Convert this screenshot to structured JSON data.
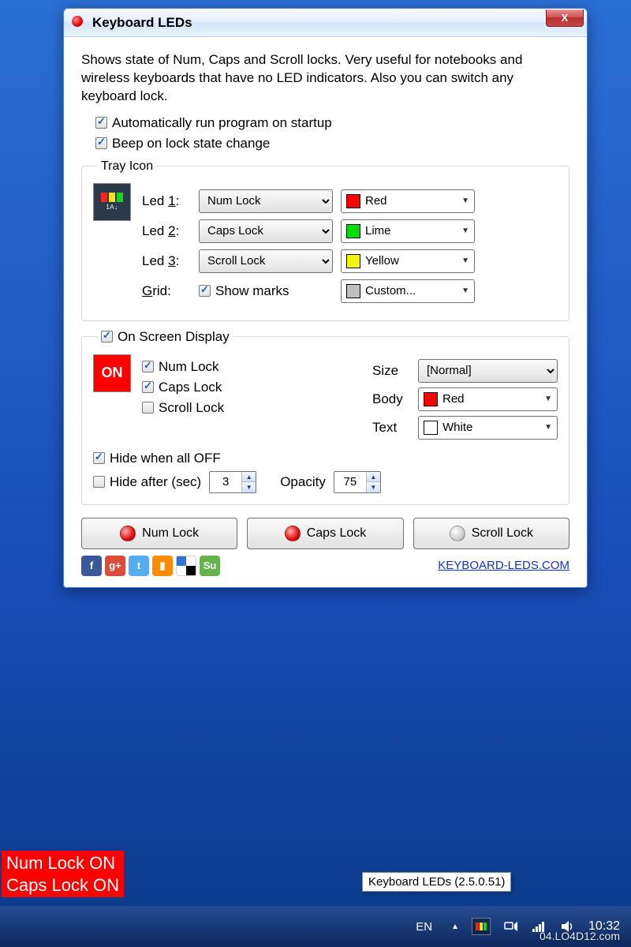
{
  "window": {
    "title": "Keyboard LEDs",
    "close_glyph": "X"
  },
  "description": "Shows state of Num, Caps and Scroll locks. Very useful for notebooks and wireless keyboards that have no LED indicators. Also you can switch any keyboard lock.",
  "opt_autorun": "Automatically run program on startup",
  "opt_beep": "Beep on lock state change",
  "tray": {
    "legend": "Tray Icon",
    "icon_sub": "1A↓",
    "leds": [
      {
        "label_pre": "Led ",
        "key": "1",
        "label_post": ":",
        "lock": "Num Lock",
        "color_name": "Red",
        "swatch": "#ff0000"
      },
      {
        "label_pre": "Led ",
        "key": "2",
        "label_post": ":",
        "lock": "Caps Lock",
        "color_name": "Lime",
        "swatch": "#00e000"
      },
      {
        "label_pre": "Led ",
        "key": "3",
        "label_post": ":",
        "lock": "Scroll Lock",
        "color_name": "Yellow",
        "swatch": "#f5f500"
      }
    ],
    "grid_label_pre": "G",
    "grid_label_post": "rid:",
    "grid_show": "Show marks",
    "grid_color_name": "Custom...",
    "grid_swatch": "#bfbfbf"
  },
  "osd": {
    "legend": "On Screen Display",
    "icon_text": "ON",
    "chk_num": "Num Lock",
    "chk_caps": "Caps Lock",
    "chk_scroll": "Scroll Lock",
    "chk_hide_all": "Hide when all OFF",
    "chk_hide_after": "Hide after (sec)",
    "hide_after_value": "3",
    "opacity_label": "Opacity",
    "opacity_value": "75",
    "size_label": "Size",
    "size_value": "[Normal]",
    "body_label": "Body",
    "body_color_name": "Red",
    "body_swatch": "#ff0000",
    "text_label": "Text",
    "text_color_name": "White",
    "text_swatch": "#ffffff"
  },
  "buttons": {
    "num": "Num Lock",
    "caps": "Caps Lock",
    "scroll": "Scroll Lock"
  },
  "footer": {
    "url": "KEYBOARD-LEDS.COM"
  },
  "overlay": {
    "line1": "Num Lock ON",
    "line2": "Caps Lock ON"
  },
  "tooltip": "Keyboard LEDs (2.5.0.51)",
  "taskbar": {
    "lang": "EN",
    "time": "10:32",
    "watermark": "04.LO4D12.com"
  }
}
